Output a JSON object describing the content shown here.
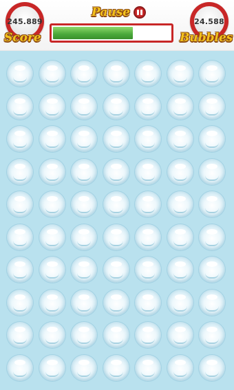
{
  "hud": {
    "score_value": "245.889",
    "score_label": "Score",
    "bubbles_value": "24.588",
    "bubbles_label": "Bubbles",
    "pause_label": "Pause"
  },
  "progress": {
    "fraction": 0.68,
    "color": "#4aa83a"
  },
  "colors": {
    "accent": "#c82727",
    "label_fill": "#f4c21d",
    "label_outline": "#8b4a12",
    "background": "#b9e1ee"
  },
  "icons": {
    "pause": "pause-icon"
  },
  "board": {
    "rows": 10,
    "cols": 7,
    "bubbles_intact": 70
  }
}
